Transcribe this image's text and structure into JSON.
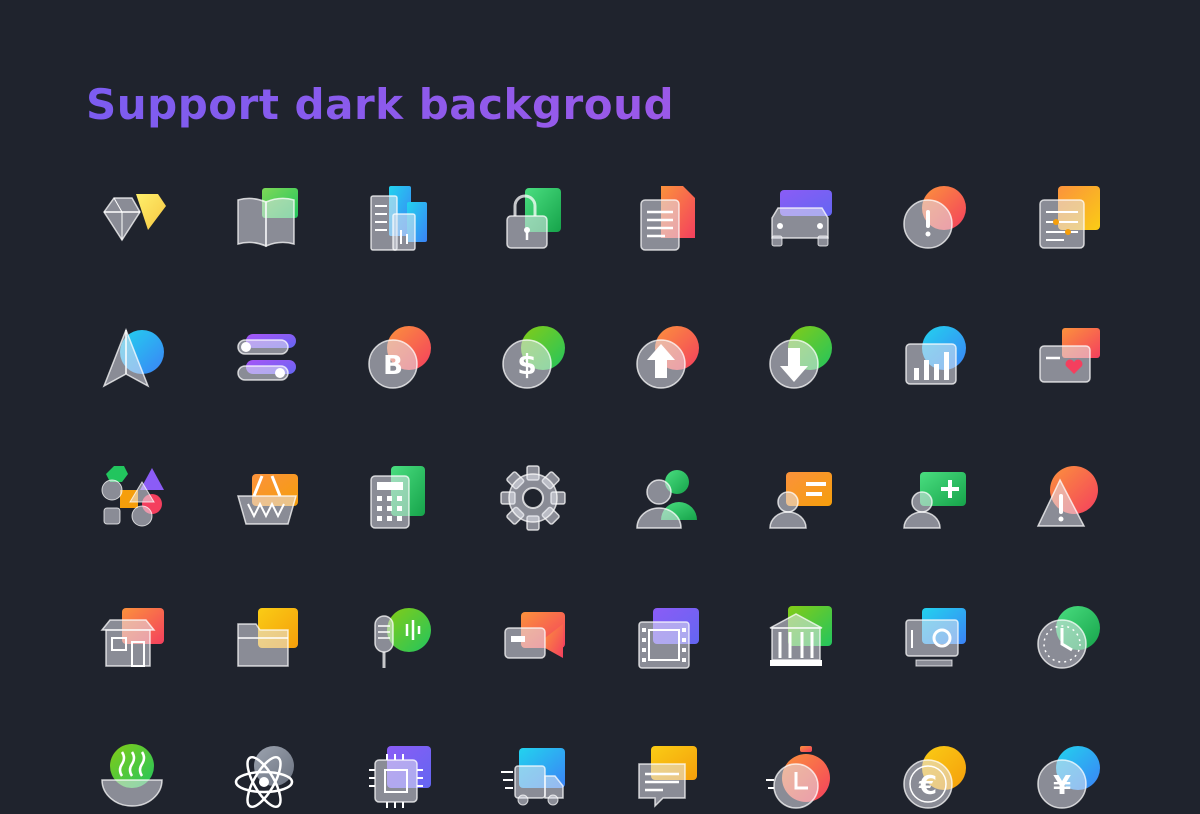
{
  "title": "Support dark backgroud",
  "colors": {
    "background": "#1f232d",
    "title": "#8b5cf6",
    "glass": "#d9dde6"
  },
  "icons": [
    {
      "name": "diamond-icon",
      "a": "#fff06b",
      "b": "#f5c542",
      "kind": "diamond"
    },
    {
      "name": "book-icon",
      "a": "#7ed957",
      "b": "#22c55e",
      "kind": "book"
    },
    {
      "name": "buildings-icon",
      "a": "#22d3ee",
      "b": "#3b82f6",
      "kind": "buildings"
    },
    {
      "name": "lock-icon",
      "a": "#4ade80",
      "b": "#16a34a",
      "kind": "lock"
    },
    {
      "name": "document-icon",
      "a": "#fb923c",
      "b": "#f43f5e",
      "kind": "document"
    },
    {
      "name": "car-icon",
      "a": "#8b5cf6",
      "b": "#6366f1",
      "kind": "car"
    },
    {
      "name": "alert-circle-icon",
      "a": "#fb923c",
      "b": "#f43f5e",
      "kind": "alert"
    },
    {
      "name": "settings-list-icon",
      "a": "#fb923c",
      "b": "#facc15",
      "kind": "settingslist"
    },
    {
      "name": "send-icon",
      "a": "#22d3ee",
      "b": "#3b82f6",
      "kind": "send"
    },
    {
      "name": "toggles-icon",
      "a": "#a855f7",
      "b": "#6366f1",
      "kind": "toggles"
    },
    {
      "name": "bitcoin-icon",
      "a": "#fb923c",
      "b": "#f43f5e",
      "kind": "bitcoin"
    },
    {
      "name": "dollar-coin-icon",
      "a": "#84cc16",
      "b": "#22c55e",
      "kind": "dollar"
    },
    {
      "name": "upload-icon",
      "a": "#fb923c",
      "b": "#f43f5e",
      "kind": "upload"
    },
    {
      "name": "download-icon",
      "a": "#84cc16",
      "b": "#22c55e",
      "kind": "download"
    },
    {
      "name": "bar-chart-icon",
      "a": "#22d3ee",
      "b": "#3b82f6",
      "kind": "barchart"
    },
    {
      "name": "heart-card-icon",
      "a": "#fb923c",
      "b": "#f43f5e",
      "kind": "heartcard"
    },
    {
      "name": "shapes-icon",
      "a": "#22c55e",
      "b": "#8b5cf6",
      "kind": "shapes"
    },
    {
      "name": "basket-icon",
      "a": "#fb923c",
      "b": "#f59e0b",
      "kind": "basket"
    },
    {
      "name": "calculator-icon",
      "a": "#4ade80",
      "b": "#16a34a",
      "kind": "calculator"
    },
    {
      "name": "gear-icon",
      "a": "#9ca3af",
      "b": "#6b7280",
      "kind": "gear"
    },
    {
      "name": "user-icon",
      "a": "#4ade80",
      "b": "#16a34a",
      "kind": "user"
    },
    {
      "name": "id-card-icon",
      "a": "#fb923c",
      "b": "#f59e0b",
      "kind": "idcard"
    },
    {
      "name": "add-user-icon",
      "a": "#4ade80",
      "b": "#16a34a",
      "kind": "adduser"
    },
    {
      "name": "warning-icon",
      "a": "#fb923c",
      "b": "#f43f5e",
      "kind": "warning"
    },
    {
      "name": "store-icon",
      "a": "#fb923c",
      "b": "#f43f5e",
      "kind": "store"
    },
    {
      "name": "folder-icon",
      "a": "#facc15",
      "b": "#f59e0b",
      "kind": "folder"
    },
    {
      "name": "microphone-icon",
      "a": "#84cc16",
      "b": "#22c55e",
      "kind": "mic"
    },
    {
      "name": "video-camera-icon",
      "a": "#fb923c",
      "b": "#f43f5e",
      "kind": "video"
    },
    {
      "name": "film-icon",
      "a": "#8b5cf6",
      "b": "#6366f1",
      "kind": "film"
    },
    {
      "name": "bank-icon",
      "a": "#84cc16",
      "b": "#22c55e",
      "kind": "bank"
    },
    {
      "name": "monitor-chart-icon",
      "a": "#22d3ee",
      "b": "#3b82f6",
      "kind": "monitor"
    },
    {
      "name": "clock-icon",
      "a": "#4ade80",
      "b": "#16a34a",
      "kind": "clock"
    },
    {
      "name": "bowl-icon",
      "a": "#84cc16",
      "b": "#22c55e",
      "kind": "bowl"
    },
    {
      "name": "atom-icon",
      "a": "#9ca3af",
      "b": "#6b7280",
      "kind": "atom"
    },
    {
      "name": "chip-icon",
      "a": "#8b5cf6",
      "b": "#6366f1",
      "kind": "chip"
    },
    {
      "name": "delivery-truck-icon",
      "a": "#22d3ee",
      "b": "#3b82f6",
      "kind": "truck"
    },
    {
      "name": "chat-icon",
      "a": "#facc15",
      "b": "#f59e0b",
      "kind": "chat"
    },
    {
      "name": "stopwatch-icon",
      "a": "#fb923c",
      "b": "#f43f5e",
      "kind": "stopwatch"
    },
    {
      "name": "euro-coin-icon",
      "a": "#facc15",
      "b": "#f59e0b",
      "kind": "euro"
    },
    {
      "name": "yen-coin-icon",
      "a": "#22d3ee",
      "b": "#3b82f6",
      "kind": "yen"
    }
  ]
}
